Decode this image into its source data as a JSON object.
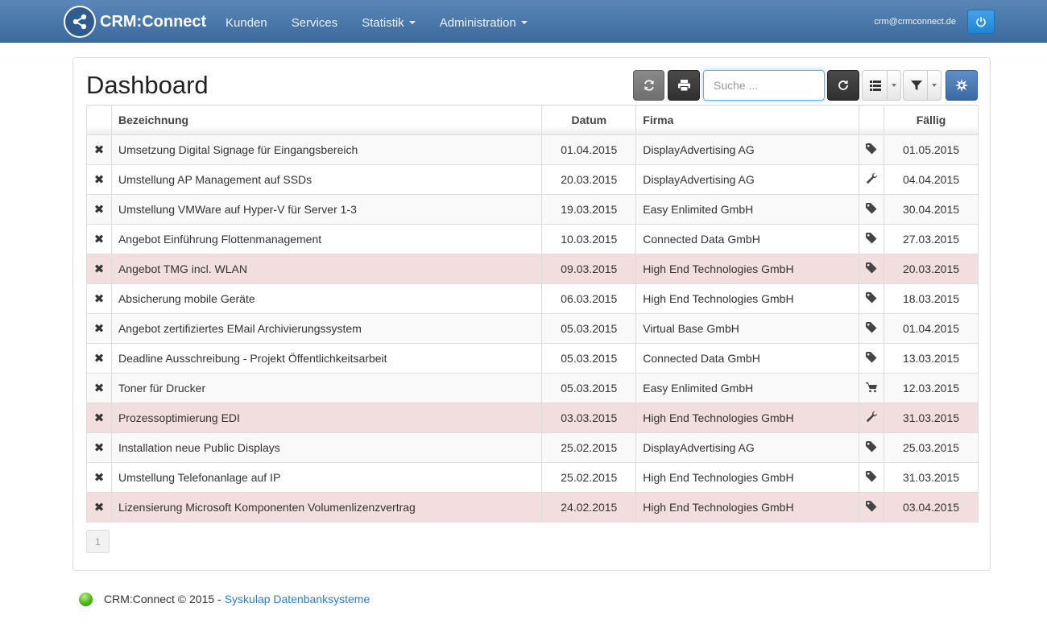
{
  "navbar": {
    "brand": "CRM:Connect",
    "links": [
      {
        "label": "Kunden",
        "dropdown": false
      },
      {
        "label": "Services",
        "dropdown": false
      },
      {
        "label": "Statistik",
        "dropdown": true
      },
      {
        "label": "Administration",
        "dropdown": true
      }
    ],
    "user_email": "crm@crmconnect.de",
    "power_icon": "power-icon"
  },
  "dashboard": {
    "title": "Dashboard",
    "search": {
      "placeholder": "Suche ...",
      "value": ""
    },
    "toolbar_icons": [
      "refresh-icon",
      "print-icon",
      "reload-icon",
      "list-icon",
      "filter-icon",
      "settings-icon"
    ]
  },
  "table": {
    "headers": {
      "name": "Bezeichnung",
      "date": "Datum",
      "company": "Firma",
      "icon": "",
      "due": "Fällig"
    },
    "rows": [
      {
        "name": "Umsetzung Digital Signage für Eingangsbereich",
        "date": "01.04.2015",
        "company": "DisplayAdvertising AG",
        "icon": "tag",
        "due": "01.05.2015",
        "highlight": false
      },
      {
        "name": "Umstellung AP Management auf SSDs",
        "date": "20.03.2015",
        "company": "DisplayAdvertising AG",
        "icon": "wrench",
        "due": "04.04.2015",
        "highlight": false
      },
      {
        "name": "Umstellung VMWare auf Hyper-V für Server 1-3",
        "date": "19.03.2015",
        "company": "Easy Enlimited GmbH",
        "icon": "tag",
        "due": "30.04.2015",
        "highlight": false
      },
      {
        "name": "Angebot Einführung Flottenmanagement",
        "date": "10.03.2015",
        "company": "Connected Data GmbH",
        "icon": "tag",
        "due": "27.03.2015",
        "highlight": false
      },
      {
        "name": "Angebot TMG incl. WLAN",
        "date": "09.03.2015",
        "company": "High End Technologies GmbH",
        "icon": "tag",
        "due": "20.03.2015",
        "highlight": true
      },
      {
        "name": "Absicherung mobile Geräte",
        "date": "06.03.2015",
        "company": "High End Technologies GmbH",
        "icon": "tag",
        "due": "18.03.2015",
        "highlight": false
      },
      {
        "name": "Angebot zertifiziertes EMail Archivierungssystem",
        "date": "05.03.2015",
        "company": "Virtual Base GmbH",
        "icon": "tag",
        "due": "01.04.2015",
        "highlight": false
      },
      {
        "name": "Deadline Ausschreibung - Projekt Öffentlichkeitsarbeit",
        "date": "05.03.2015",
        "company": "Connected Data GmbH",
        "icon": "tag",
        "due": "13.03.2015",
        "highlight": false
      },
      {
        "name": "Toner für Drucker",
        "date": "05.03.2015",
        "company": "Easy Enlimited GmbH",
        "icon": "cart",
        "due": "12.03.2015",
        "highlight": false
      },
      {
        "name": "Prozessoptimierung EDI",
        "date": "03.03.2015",
        "company": "High End Technologies GmbH",
        "icon": "wrench",
        "due": "31.03.2015",
        "highlight": true
      },
      {
        "name": "Installation neue Public Displays",
        "date": "25.02.2015",
        "company": "DisplayAdvertising AG",
        "icon": "tag",
        "due": "25.03.2015",
        "highlight": false
      },
      {
        "name": "Umstellung Telefonanlage auf IP",
        "date": "25.02.2015",
        "company": "High End Technologies GmbH",
        "icon": "tag",
        "due": "31.03.2015",
        "highlight": false
      },
      {
        "name": "Lizensierung Microsoft Komponenten Volumenlizenzvertrag",
        "date": "24.02.2015",
        "company": "High End Technologies GmbH",
        "icon": "tag",
        "due": "03.04.2015",
        "highlight": true
      }
    ]
  },
  "pagination": {
    "current": "1"
  },
  "footer": {
    "text": "CRM:Connect © 2015 -",
    "link": "Syskulap Datenbanksysteme"
  },
  "colors": {
    "navbar": "#4a77ab",
    "danger_row": "#f2dede",
    "link": "#2a7fcf",
    "primary_button": "#3b6aa3"
  }
}
